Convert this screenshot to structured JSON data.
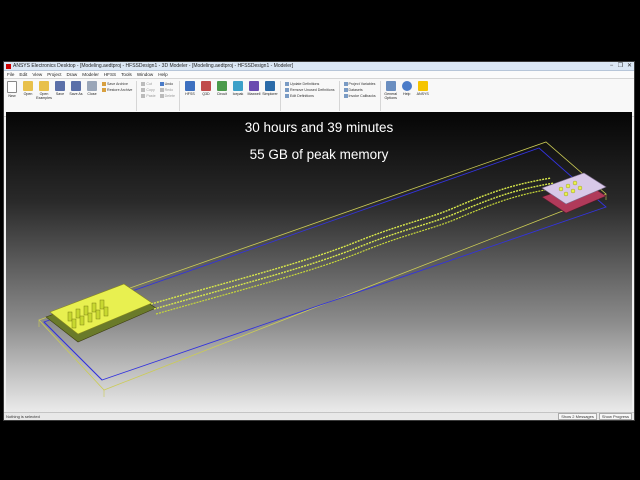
{
  "window": {
    "title": "ANSYS Electronics Desktop - [Modeling.aedtproj - HFSSDesign1 - 3D Modeler - [Modeling.aedtproj - HFSSDesign1 - Modeler]",
    "controls": [
      "−",
      "❐",
      "✕"
    ]
  },
  "menu": [
    "File",
    "Edit",
    "View",
    "Project",
    "Draw",
    "Modeler",
    "HFSS",
    "Tools",
    "Window",
    "Help"
  ],
  "ribbon": {
    "file_buttons": [
      "New",
      "Open",
      "Open Examples",
      "Save",
      "Save As",
      "Close"
    ],
    "archive": [
      "Save Archive",
      "Restore Archive"
    ],
    "edit_small": [
      "Cut",
      "Undo",
      "Copy",
      "Redo",
      "Paste",
      "Delete"
    ],
    "design_buttons": [
      "HFSS",
      "Q3D",
      "Circuit",
      "Icepak",
      "Maxwell",
      "Simplorer"
    ],
    "definitions": [
      "Update Definitions",
      "Remove Unused Definitions",
      "Edit Definitions"
    ],
    "variables": [
      "Project Variables",
      "Datasets",
      "Invoke Callbacks"
    ],
    "right_buttons": [
      "General Options",
      "Help",
      "ANSYS"
    ],
    "groups": [
      "Desktop",
      "View",
      "Draw",
      "Model",
      "Simulation",
      "Results",
      "Automation"
    ]
  },
  "overlay": {
    "line1": "30 hours and  39 minutes",
    "line2": "55 GB of peak memory"
  },
  "status": {
    "message": "Nothing is selected",
    "buttons": [
      "Show 2 Messages",
      "Show Progress"
    ]
  },
  "colors": {
    "box_outline": "#3333dd",
    "airbox_outline": "#cccc55",
    "traces": "#d8e84a",
    "chip": "#e8f050",
    "connector": "#d8c8e8"
  }
}
